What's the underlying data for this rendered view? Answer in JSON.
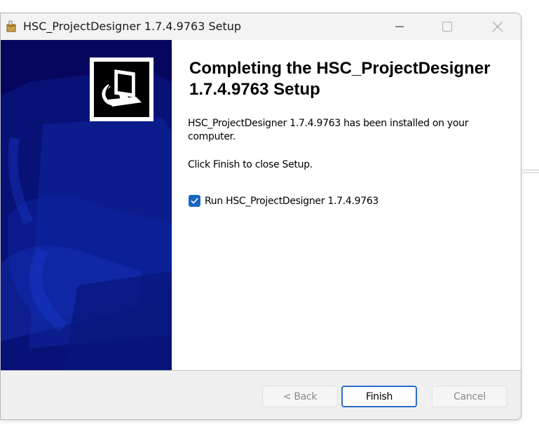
{
  "window": {
    "title": "HSC_ProjectDesigner 1.7.4.9763 Setup",
    "minimize_icon": "minimize-icon",
    "maximize_icon": "maximize-icon",
    "close_icon": "close-icon",
    "app_icon": "installer-box-icon"
  },
  "sidebar": {
    "background_color": "#06065e",
    "logo_icon": "computer-installer-icon"
  },
  "content": {
    "heading": "Completing the HSC_ProjectDesigner 1.7.4.9763 Setup",
    "installed_text": "HSC_ProjectDesigner 1.7.4.9763 has been installed on your computer.",
    "click_finish_text": "Click Finish to close Setup.",
    "run_checkbox": {
      "label": "Run HSC_ProjectDesigner 1.7.4.9763",
      "checked": true
    }
  },
  "buttons": {
    "back_label": "< Back",
    "finish_label": "Finish",
    "cancel_label": "Cancel"
  },
  "colors": {
    "accent": "#2a6fc9",
    "checkbox": "#1a66c2"
  }
}
